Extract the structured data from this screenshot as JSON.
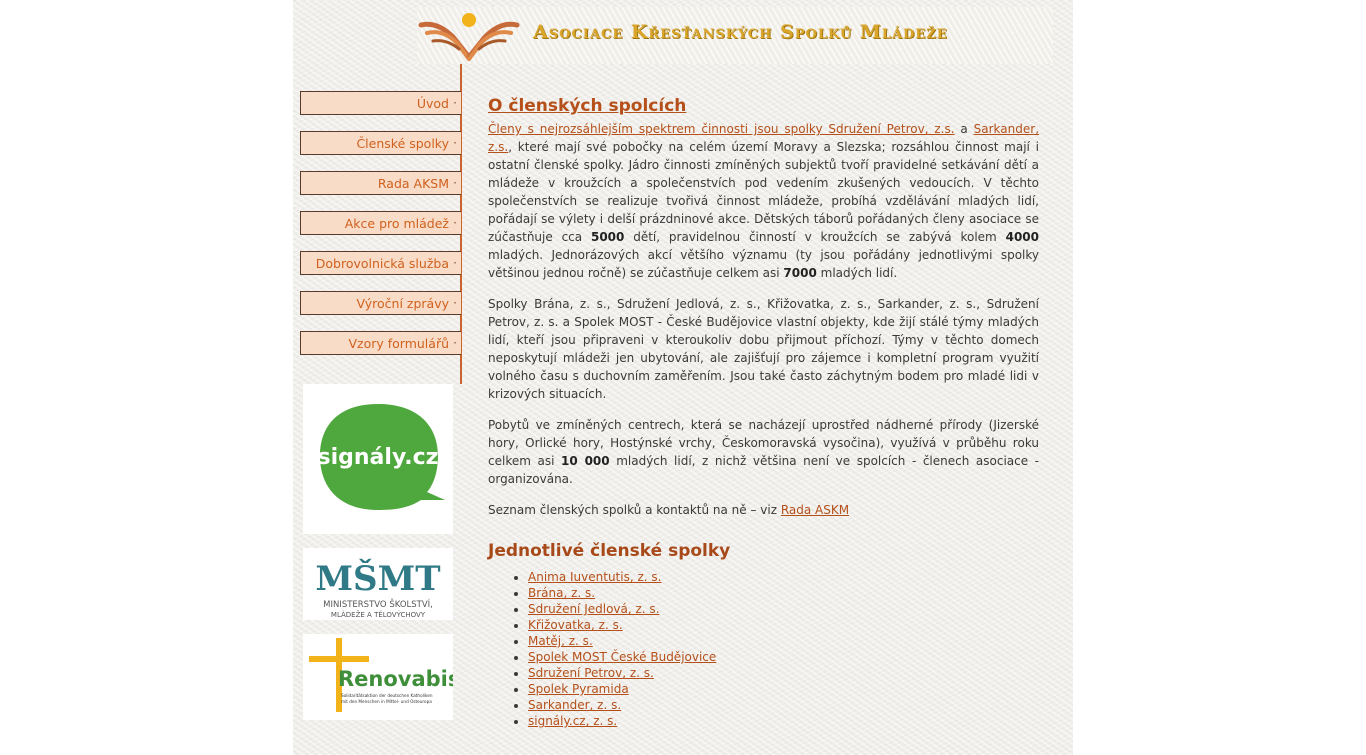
{
  "banner": {
    "title": "Asociace Křesťanských Spolků Mládeže"
  },
  "nav": {
    "items": [
      {
        "label": "Úvod"
      },
      {
        "label": "Členské spolky"
      },
      {
        "label": "Rada AKSM"
      },
      {
        "label": "Akce pro mládež"
      },
      {
        "label": "Dobrovolnická služba"
      },
      {
        "label": "Výroční zprávy"
      },
      {
        "label": "Vzory formulářů"
      }
    ],
    "dot": "·"
  },
  "logos": {
    "signaly": "signály.cz",
    "msmt_letters": "MŠMT",
    "msmt_line1": "MINISTERSTVO ŠKOLSTVÍ,",
    "msmt_line2": "MLÁDEŽE A TĚLOVÝCHOVY",
    "renovabis": "Renovabis",
    "renovabis_sub1": "Solidaritätsaktion der deutschen Katholiken",
    "renovabis_sub2": "mit den Menschen in Mittel- und Osteuropa"
  },
  "content": {
    "heading": "O členských spolcích",
    "p1_link1": "Členy s nejrozsáhlejším spektrem činnosti jsou spolky Sdružení Petrov, z.s.",
    "p1_and": " a ",
    "p1_link2": "Sarkander, z.s.",
    "p1_text1": ", které mají své pobočky na celém území Moravy a Slezska; rozsáhlou činnost mají i ostatní členské spolky. Jádro činnosti zmíněných subjektů tvoří pravidelné setkávání dětí a mládeže v kroužcích a společenstvích pod vedením zkušených vedoucích. V těchto společenstvích se realizuje tvořivá činnost mládeže, probíhá vzdělávání mladých lidí, pořádají se výlety i delší prázdninové akce. Dětských táborů pořádaných členy asociace se zúčastňuje cca ",
    "p1_num1": "5000",
    "p1_text2": " dětí, pravidelnou činností v kroužcích se zabývá kolem ",
    "p1_num2": "4000",
    "p1_text3": " mladých. Jednorázových akcí většího významu (ty jsou pořádány jednotlivými spolky většinou jednou ročně) se zúčastňuje celkem asi ",
    "p1_num3": "7000",
    "p1_text4": " mladých lidí.",
    "p2": "Spolky Brána, z. s., Sdružení Jedlová, z. s., Křižovatka, z. s., Sarkander, z. s., Sdružení Petrov, z. s. a Spolek MOST - České Budějovice vlastní objekty, kde žijí stálé týmy mladých lidí, kteří jsou připraveni v kteroukoliv dobu přijmout příchozí. Týmy v těchto domech neposkytují mládeži jen ubytování, ale zajišťují pro zájemce i kompletní program využití volného času s duchovním zaměřením. Jsou také často záchytným bodem pro mladé lidi v krizových situacích.",
    "p3_text1": "Pobytů ve zmíněných centrech, která se nacházejí uprostřed nádherné přírody (Jizerské hory, Orlické hory, Hostýnské vrchy, Českomoravská vysočina), využívá v průběhu roku celkem asi ",
    "p3_num": "10 000",
    "p3_text2": " mladých lidí, z nichž většina není ve spolcích - členech asociace - organizována.",
    "p4_text": "Seznam členských spolků a kontaktů na ně – viz ",
    "p4_link": "Rada ASKM",
    "heading2": "Jednotlivé členské spolky",
    "members": [
      "Anima Iuventutis, z. s.",
      "Brána, z. s.",
      "Sdružení Jedlová, z. s.",
      "Křižovatka, z. s.",
      "Matěj, z. s.",
      "Spolek MOST České Budějovice",
      "Sdružení Petrov, z. s.",
      "Spolek Pyramida",
      "Sarkander, z. s.",
      "signály.cz, z. s."
    ]
  },
  "colors": {
    "accent": "#b5501a",
    "nav_bg": "#f8dcc7",
    "divider": "#c8642c"
  }
}
